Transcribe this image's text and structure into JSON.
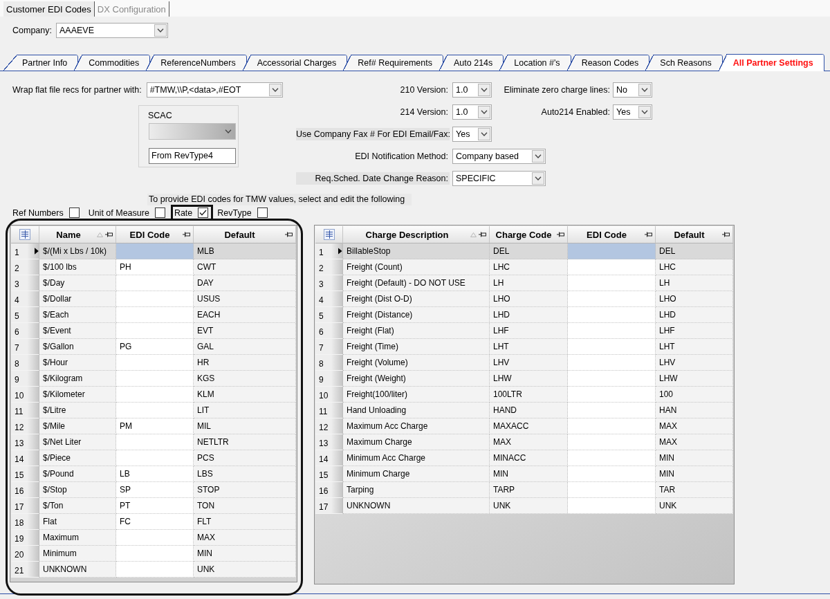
{
  "top_tabs": [
    {
      "label": "Customer EDI Codes",
      "selected": true
    },
    {
      "label": "DX Configuration",
      "selected": false
    }
  ],
  "company": {
    "label": "Company:",
    "value": "AAAEVE"
  },
  "tabs": [
    {
      "label": "Partner Info",
      "selected": false
    },
    {
      "label": "Commodities",
      "selected": false
    },
    {
      "label": "ReferenceNumbers",
      "selected": false
    },
    {
      "label": "Accessorial Charges",
      "selected": false
    },
    {
      "label": "Ref# Requirements",
      "selected": false
    },
    {
      "label": "Auto 214s",
      "selected": false
    },
    {
      "label": "Location #'s",
      "selected": false
    },
    {
      "label": "Reason Codes",
      "selected": false
    },
    {
      "label": "Sch Reasons",
      "selected": false
    },
    {
      "label": "All Partner Settings",
      "selected": true
    }
  ],
  "wrap": {
    "label": "Wrap flat file recs for partner with:",
    "value": "#TMW,\\\\P,<data>,#EOT"
  },
  "scac": {
    "title": "SCAC",
    "text_value": "From RevType4"
  },
  "settings": [
    {
      "label": "210 Version:",
      "value": "1.0",
      "shaded": false
    },
    {
      "label": "214 Version:",
      "value": "1.0",
      "shaded": false
    },
    {
      "label": "Use Company Fax # For EDI Email/Fax:",
      "value": "Yes",
      "shaded": true
    },
    {
      "label": "EDI Notification Method:",
      "value": "Company based",
      "shaded": false
    },
    {
      "label": "Req.Sched. Date Change Reason:",
      "value": "SPECIFIC",
      "shaded": true
    }
  ],
  "side_settings": [
    {
      "label": "Eliminate zero charge lines:",
      "value": "No"
    },
    {
      "label": "Auto214 Enabled:",
      "value": "Yes"
    }
  ],
  "note": "To provide EDI codes for TMW values, select and edit the following",
  "code_types": [
    {
      "label": "Ref Numbers",
      "checked": false,
      "highlighted": false
    },
    {
      "label": "Unit of Measure",
      "checked": false,
      "highlighted": false
    },
    {
      "label": "Rate",
      "checked": true,
      "highlighted": true
    },
    {
      "label": "RevType",
      "checked": false,
      "highlighted": false
    }
  ],
  "rate_grid": {
    "highlighted": true,
    "columns": [
      {
        "label": "Name",
        "sorted": true,
        "editable": false
      },
      {
        "label": "EDI Code",
        "sorted": false,
        "editable": true
      },
      {
        "label": "Default",
        "sorted": false,
        "editable": false
      }
    ],
    "rows": [
      {
        "number": "1",
        "selected": true,
        "name": "$/(Mi x Lbs / 10k)",
        "default": "MLB"
      },
      {
        "number": "2",
        "selected": false,
        "name": "$/100 lbs",
        "edi_code": "PH",
        "default": "CWT"
      },
      {
        "number": "3",
        "selected": false,
        "name": "$/Day",
        "default": "DAY"
      },
      {
        "number": "4",
        "selected": false,
        "name": "$/Dollar",
        "default": "USUS"
      },
      {
        "number": "5",
        "selected": false,
        "name": "$/Each",
        "default": "EACH"
      },
      {
        "number": "6",
        "selected": false,
        "name": "$/Event",
        "default": "EVT"
      },
      {
        "number": "7",
        "selected": false,
        "name": "$/Gallon",
        "edi_code": "PG",
        "default": "GAL"
      },
      {
        "number": "8",
        "selected": false,
        "name": "$/Hour",
        "default": "HR"
      },
      {
        "number": "9",
        "selected": false,
        "name": "$/Kilogram",
        "default": "KGS"
      },
      {
        "number": "10",
        "selected": false,
        "name": "$/Kilometer",
        "default": "KLM"
      },
      {
        "number": "11",
        "selected": false,
        "name": "$/Litre",
        "default": "LIT"
      },
      {
        "number": "12",
        "selected": false,
        "name": "$/Mile",
        "edi_code": "PM",
        "default": "MIL"
      },
      {
        "number": "13",
        "selected": false,
        "name": "$/Net Liter",
        "default": "NETLTR"
      },
      {
        "number": "14",
        "selected": false,
        "name": "$/Piece",
        "default": "PCS"
      },
      {
        "number": "15",
        "selected": false,
        "name": "$/Pound",
        "edi_code": "LB",
        "default": "LBS"
      },
      {
        "number": "16",
        "selected": false,
        "name": "$/Stop",
        "edi_code": "SP",
        "default": "STOP"
      },
      {
        "number": "17",
        "selected": false,
        "name": "$/Ton",
        "edi_code": "PT",
        "default": "TON"
      },
      {
        "number": "18",
        "selected": false,
        "name": "Flat",
        "edi_code": "FC",
        "default": "FLT"
      },
      {
        "number": "19",
        "selected": false,
        "name": "Maximum",
        "default": "MAX"
      },
      {
        "number": "20",
        "selected": false,
        "name": "Minimum",
        "default": "MIN"
      },
      {
        "number": "21",
        "selected": false,
        "name": "UNKNOWN",
        "default": "UNK"
      }
    ]
  },
  "charge_grid": {
    "highlighted": false,
    "columns": [
      {
        "label": "Charge Description",
        "sorted": true,
        "editable": false
      },
      {
        "label": "Charge Code",
        "sorted": false,
        "editable": false
      },
      {
        "label": "EDI Code",
        "sorted": false,
        "editable": true
      },
      {
        "label": "Default",
        "sorted": false,
        "editable": false
      }
    ],
    "rows": [
      {
        "number": "1",
        "selected": true,
        "description": "BillableStop",
        "charge_code": "DEL",
        "default": "DEL"
      },
      {
        "number": "2",
        "selected": false,
        "description": "Freight (Count)",
        "charge_code": "LHC",
        "default": "LHC"
      },
      {
        "number": "3",
        "selected": false,
        "description": "Freight (Default) - DO NOT USE",
        "charge_code": "LH",
        "default": "LH"
      },
      {
        "number": "4",
        "selected": false,
        "description": "Freight (Dist O-D)",
        "charge_code": "LHO",
        "default": "LHO"
      },
      {
        "number": "5",
        "selected": false,
        "description": "Freight (Distance)",
        "charge_code": "LHD",
        "default": "LHD"
      },
      {
        "number": "6",
        "selected": false,
        "description": "Freight (Flat)",
        "charge_code": "LHF",
        "default": "LHF"
      },
      {
        "number": "7",
        "selected": false,
        "description": "Freight (Time)",
        "charge_code": "LHT",
        "default": "LHT"
      },
      {
        "number": "8",
        "selected": false,
        "description": "Freight (Volume)",
        "charge_code": "LHV",
        "default": "LHV"
      },
      {
        "number": "9",
        "selected": false,
        "description": "Freight (Weight)",
        "charge_code": "LHW",
        "default": "LHW"
      },
      {
        "number": "10",
        "selected": false,
        "description": "Freight(100/liter)",
        "charge_code": "100LTR",
        "default": "100"
      },
      {
        "number": "11",
        "selected": false,
        "description": "Hand Unloading",
        "charge_code": "HAND",
        "default": "HAN"
      },
      {
        "number": "12",
        "selected": false,
        "description": "Maximum Acc Charge",
        "charge_code": "MAXACC",
        "default": "MAX"
      },
      {
        "number": "13",
        "selected": false,
        "description": "Maximum Charge",
        "charge_code": "MAX",
        "default": "MAX"
      },
      {
        "number": "14",
        "selected": false,
        "description": "Minimum Acc Charge",
        "charge_code": "MINACC",
        "default": "MIN"
      },
      {
        "number": "15",
        "selected": false,
        "description": "Minimum Charge",
        "charge_code": "MIN",
        "default": "MIN"
      },
      {
        "number": "16",
        "selected": false,
        "description": "Tarping",
        "charge_code": "TARP",
        "default": "TAR"
      },
      {
        "number": "17",
        "selected": false,
        "description": "UNKNOWN",
        "charge_code": "UNK",
        "default": "UNK"
      }
    ]
  }
}
